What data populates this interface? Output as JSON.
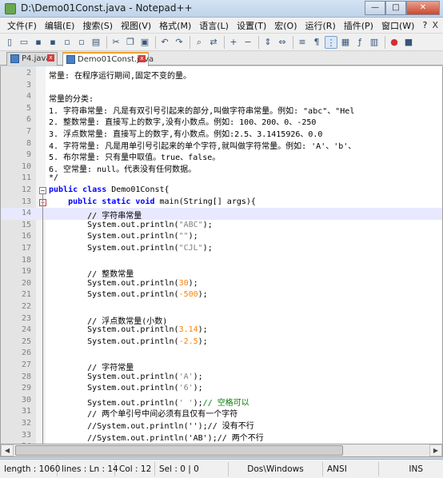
{
  "window": {
    "title": "D:\\Demo01Const.java - Notepad++",
    "minimize": "—",
    "maximize": "□",
    "close": "✕"
  },
  "menu": [
    "文件(F)",
    "编辑(E)",
    "搜索(S)",
    "视图(V)",
    "格式(M)",
    "语言(L)",
    "设置(T)",
    "宏(O)",
    "运行(R)",
    "插件(P)",
    "窗口(W)",
    "?"
  ],
  "menu_close": "X",
  "tabs": [
    {
      "label": "P4.java"
    },
    {
      "label": "Demo01Const.java"
    }
  ],
  "lines": [
    {
      "n": "2",
      "code": "常量: 在程序运行期间,固定不变的量。",
      "type": "cmt"
    },
    {
      "n": "3",
      "code": "",
      "type": "plain"
    },
    {
      "n": "4",
      "code": "常量的分类:",
      "type": "cmt"
    },
    {
      "n": "5",
      "code": "1. 字符串常量: 凡是有双引号引起来的部分,叫做字符串常量。例如: \"abc\"、\"Hel",
      "type": "cmt"
    },
    {
      "n": "6",
      "code": "2. 整数常量: 直接写上的数字,没有小数点。例如: 100、200、0、-250",
      "type": "cmt"
    },
    {
      "n": "7",
      "code": "3. 浮点数常量: 直接写上的数字,有小数点。例如:2.5、3.1415926、0.0",
      "type": "cmt"
    },
    {
      "n": "8",
      "code": "4. 字符常量: 凡是用单引号引起来的单个字符,就叫做字符常量。例如: 'A'、'b'、",
      "type": "cmt"
    },
    {
      "n": "9",
      "code": "5. 布尔常量: 只有量中取值。true、false。",
      "type": "cmt"
    },
    {
      "n": "10",
      "code": "6. 空常量: null。代表没有任何数据。",
      "type": "cmt"
    },
    {
      "n": "11",
      "code": "*/",
      "type": "cmt"
    },
    {
      "n": "12",
      "code": "public class Demo01Const{",
      "type": "class"
    },
    {
      "n": "13",
      "code": "    public static void main(String[] args){",
      "type": "method"
    },
    {
      "n": "14",
      "code": "        // 字符串常量",
      "type": "cmt"
    },
    {
      "n": "15",
      "code": "        System.out.println(\"ABC\");",
      "type": "plain"
    },
    {
      "n": "16",
      "code": "        System.out.println(\"\");",
      "type": "plain"
    },
    {
      "n": "17",
      "code": "        System.out.println(\"CJL\");",
      "type": "plain"
    },
    {
      "n": "18",
      "code": "",
      "type": "plain"
    },
    {
      "n": "19",
      "code": "        // 整数常量",
      "type": "cmt"
    },
    {
      "n": "20",
      "code": "        System.out.println(30);",
      "type": "plain"
    },
    {
      "n": "21",
      "code": "        System.out.println(-500);",
      "type": "plain"
    },
    {
      "n": "22",
      "code": "",
      "type": "plain"
    },
    {
      "n": "23",
      "code": "        // 浮点数常量(小数)",
      "type": "cmt"
    },
    {
      "n": "24",
      "code": "        System.out.println(3.14);",
      "type": "plain"
    },
    {
      "n": "25",
      "code": "        System.out.println(-2.5);",
      "type": "plain"
    },
    {
      "n": "26",
      "code": "",
      "type": "plain"
    },
    {
      "n": "27",
      "code": "        // 字符常量",
      "type": "cmt"
    },
    {
      "n": "28",
      "code": "        System.out.println('A');",
      "type": "plain"
    },
    {
      "n": "29",
      "code": "        System.out.println('6');",
      "type": "plain"
    },
    {
      "n": "30",
      "code": "        System.out.println(' ');// 空格可以",
      "type": "plain"
    },
    {
      "n": "31",
      "code": "        // 两个单引号中间必须有且仅有一个字符",
      "type": "cmt"
    },
    {
      "n": "32",
      "code": "        //System.out.println('');// 没有不行",
      "type": "cmt"
    },
    {
      "n": "33",
      "code": "        //System.out.println('AB');// 两个不行",
      "type": "cmt"
    },
    {
      "n": "34",
      "code": "",
      "type": "plain"
    }
  ],
  "status": {
    "length": "length : 1060",
    "lines": "lines : Ln : 14",
    "col": "Col : 12",
    "sel": "Sel : 0 | 0",
    "eol": "Dos\\Windows",
    "encoding": "ANSI",
    "mode": "INS"
  }
}
